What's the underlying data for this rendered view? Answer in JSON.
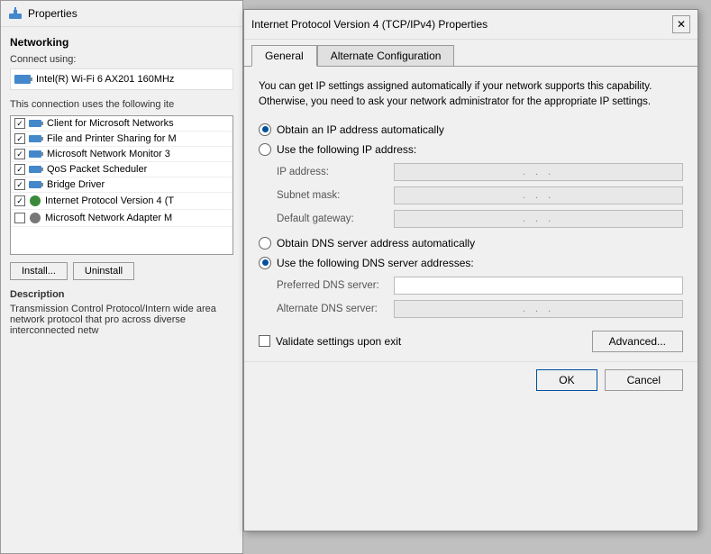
{
  "bg_window": {
    "title": "Properties",
    "networking_label": "Networking",
    "connect_using_label": "Connect using:",
    "adapter_name": "Intel(R) Wi-Fi 6 AX201 160MHz",
    "connection_uses_label": "This connection uses the following ite",
    "items": [
      {
        "checked": true,
        "label": "Client for Microsoft Networks"
      },
      {
        "checked": true,
        "label": "File and Printer Sharing for M"
      },
      {
        "checked": true,
        "label": "Microsoft Network Monitor 3"
      },
      {
        "checked": true,
        "label": "QoS Packet Scheduler"
      },
      {
        "checked": true,
        "label": "Bridge Driver"
      },
      {
        "checked": true,
        "label": "Internet Protocol Version 4 (T"
      },
      {
        "checked": false,
        "label": "Microsoft Network Adapter M"
      }
    ],
    "install_btn": "Install...",
    "uninstall_btn": "Uninstall",
    "description_title": "Description",
    "description_text": "Transmission Control Protocol/Intern wide area network protocol that pro across diverse interconnected netw"
  },
  "dialog": {
    "title": "Internet Protocol Version 4 (TCP/IPv4) Properties",
    "close_label": "✕",
    "tabs": [
      {
        "label": "General",
        "active": true
      },
      {
        "label": "Alternate Configuration",
        "active": false
      }
    ],
    "info_text": "You can get IP settings assigned automatically if your network supports this capability. Otherwise, you need to ask your network administrator for the appropriate IP settings.",
    "ip_section": {
      "auto_label": "Obtain an IP address automatically",
      "manual_label": "Use the following IP address:",
      "auto_selected": true,
      "ip_address_label": "IP address:",
      "subnet_mask_label": "Subnet mask:",
      "default_gateway_label": "Default gateway:"
    },
    "dns_section": {
      "auto_label": "Obtain DNS server address automatically",
      "manual_label": "Use the following DNS server addresses:",
      "manual_selected": true,
      "preferred_label": "Preferred DNS server:",
      "alternate_label": "Alternate DNS server:"
    },
    "validate_label": "Validate settings upon exit",
    "advanced_btn": "Advanced...",
    "ok_btn": "OK",
    "cancel_btn": "Cancel"
  }
}
